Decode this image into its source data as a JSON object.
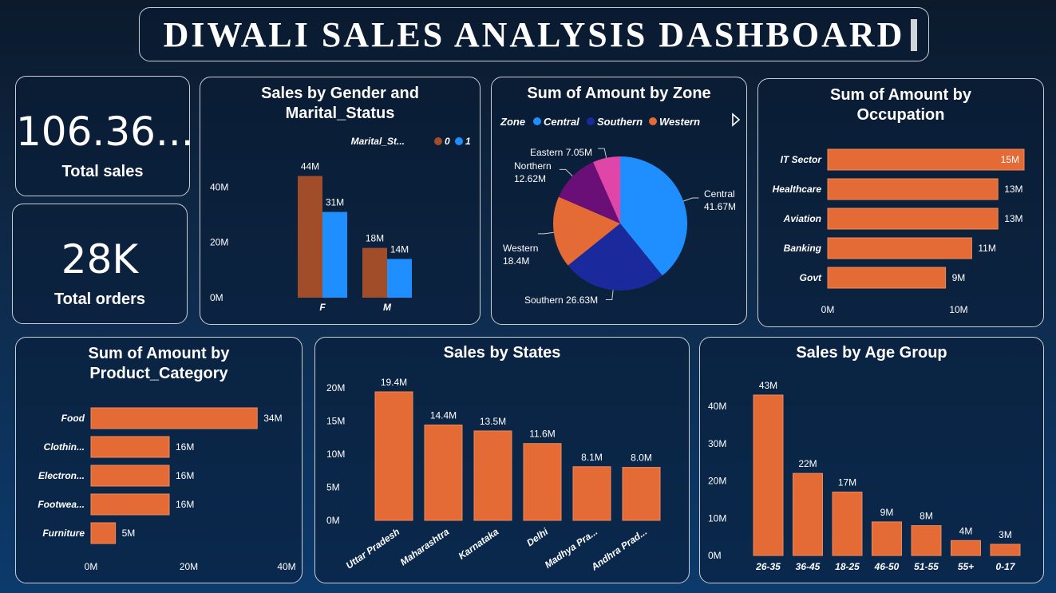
{
  "header": {
    "title": "DIWALI  SALES  ANALYSIS  DASHBOARD"
  },
  "kpis": {
    "total_sales": {
      "value": "106.36...",
      "label": "Total sales"
    },
    "total_orders": {
      "value": "28K",
      "label": "Total orders"
    }
  },
  "colors": {
    "brown": "#a24d2a",
    "blue": "#1f8fff",
    "orange": "#e46a36",
    "central": "#1f8fff",
    "southern": "#1a2a9c",
    "western": "#e46a36",
    "northern": "#6a0e78",
    "eastern": "#e045a8"
  },
  "chart_data": [
    {
      "id": "gender",
      "type": "bar",
      "title": "Sales by Gender and Marital_Status",
      "title_lines": [
        "Sales by Gender and",
        "Marital_Status"
      ],
      "legend_title": "Marital_St...",
      "categories": [
        "F",
        "M"
      ],
      "series": [
        {
          "name": "0",
          "values": [
            44,
            18
          ],
          "labels": [
            "44M",
            "18M"
          ]
        },
        {
          "name": "1",
          "values": [
            31,
            14
          ],
          "labels": [
            "31M",
            "14M"
          ]
        }
      ],
      "y_ticks": [
        "0M",
        "20M",
        "40M"
      ],
      "ylim": [
        0,
        45
      ]
    },
    {
      "id": "zone",
      "type": "pie",
      "title": "Sum of Amount by Zone",
      "legend_title": "Zone",
      "legend": [
        "Central",
        "Southern",
        "Western"
      ],
      "slices": [
        {
          "name": "Central",
          "value": 41.67,
          "label": "41.67M"
        },
        {
          "name": "Southern",
          "value": 26.63,
          "label": "26.63M"
        },
        {
          "name": "Western",
          "value": 18.4,
          "label": "18.4M"
        },
        {
          "name": "Northern",
          "value": 12.62,
          "label": "12.62M"
        },
        {
          "name": "Eastern",
          "value": 7.05,
          "label": "7.05M"
        }
      ]
    },
    {
      "id": "occupation",
      "type": "bar",
      "orientation": "horizontal",
      "title": "Sum of Amount by Occupation",
      "title_lines": [
        "Sum of Amount by",
        "Occupation"
      ],
      "categories": [
        "IT Sector",
        "Healthcare",
        "Aviation",
        "Banking",
        "Govt"
      ],
      "values": [
        15,
        13,
        13,
        11,
        9
      ],
      "labels": [
        "15M",
        "13M",
        "13M",
        "11M",
        "9M"
      ],
      "x_ticks": [
        "0M",
        "10M"
      ],
      "xlim": [
        0,
        15
      ]
    },
    {
      "id": "product",
      "type": "bar",
      "orientation": "horizontal",
      "title": "Sum of Amount by Product_Category",
      "title_lines": [
        "Sum of Amount by",
        "Product_Category"
      ],
      "categories": [
        "Food",
        "Clothin...",
        "Electron...",
        "Footwea...",
        "Furniture"
      ],
      "values": [
        34,
        16,
        16,
        16,
        5
      ],
      "labels": [
        "34M",
        "16M",
        "16M",
        "16M",
        "5M"
      ],
      "x_ticks": [
        "0M",
        "20M",
        "40M"
      ],
      "xlim": [
        0,
        40
      ]
    },
    {
      "id": "states",
      "type": "bar",
      "title": "Sales by States",
      "categories": [
        "Uttar Pradesh",
        "Maharashtra",
        "Karnataka",
        "Delhi",
        "Madhya Pra...",
        "Andhra Prad..."
      ],
      "values": [
        19.4,
        14.4,
        13.5,
        11.6,
        8.1,
        8.0
      ],
      "labels": [
        "19.4M",
        "14.4M",
        "13.5M",
        "11.6M",
        "8.1M",
        "8.0M"
      ],
      "y_ticks": [
        "0M",
        "5M",
        "10M",
        "15M",
        "20M"
      ],
      "ylim": [
        0,
        20
      ]
    },
    {
      "id": "age",
      "type": "bar",
      "title": "Sales by Age Group",
      "categories": [
        "26-35",
        "36-45",
        "18-25",
        "46-50",
        "51-55",
        "55+",
        "0-17"
      ],
      "values": [
        43,
        22,
        17,
        9,
        8,
        4,
        3
      ],
      "labels": [
        "43M",
        "22M",
        "17M",
        "9M",
        "8M",
        "4M",
        "3M"
      ],
      "y_ticks": [
        "0M",
        "10M",
        "20M",
        "30M",
        "40M"
      ],
      "ylim": [
        0,
        40
      ]
    }
  ]
}
